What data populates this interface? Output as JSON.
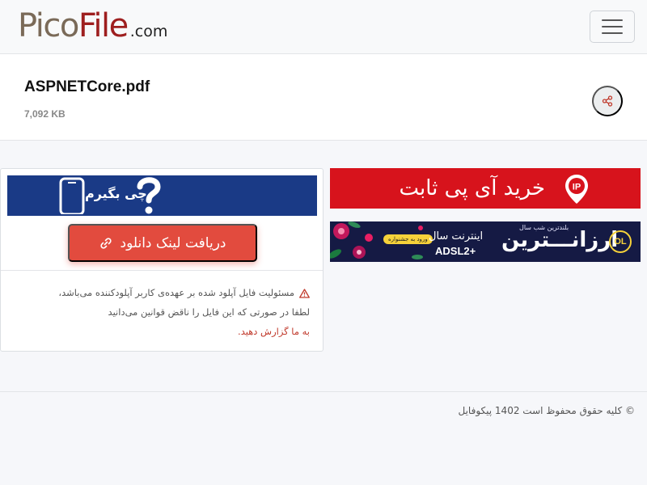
{
  "header": {
    "logo_pico": "Pico",
    "logo_file": "File",
    "logo_com": ".com",
    "menu_icon": "hamburger-menu-icon"
  },
  "file": {
    "name": "ASPNETCore.pdf",
    "size": "7,092 KB",
    "share_icon": "share-icon"
  },
  "ads": {
    "che_begiram": {
      "text": "چی بگیرم"
    },
    "ip": {
      "text": "خرید آی پی ثابت",
      "pin_text": "IP"
    },
    "arzantarin": {
      "title": "ارزانـــترین",
      "top_small": "بلندترین شب سال",
      "mid": "اینترنت سال",
      "adsl": "ADSL2+",
      "pill": "ورود به جشنواره",
      "logo": "OL"
    }
  },
  "download": {
    "label": "دریافت لینک دانلود",
    "icon": "link-icon"
  },
  "notice": {
    "line1": "مسئولیت فایل آپلود شده بر عهده‌ی کاربر آپلودکننده می‌باشد،",
    "line2": "لطفا در صورتی که این فایل را ناقض قوانین می‌دانید",
    "report_link": "به ما گزارش دهید.",
    "icon": "warning-icon"
  },
  "footer": {
    "copyright": "© کلیه حقوق محفوظ است 1402 پیکوفایل"
  },
  "colors": {
    "brand_red": "#9e1f1f",
    "download_button": "#e24b3e",
    "ip_banner": "#d7131c",
    "link_red": "#c0392b"
  }
}
